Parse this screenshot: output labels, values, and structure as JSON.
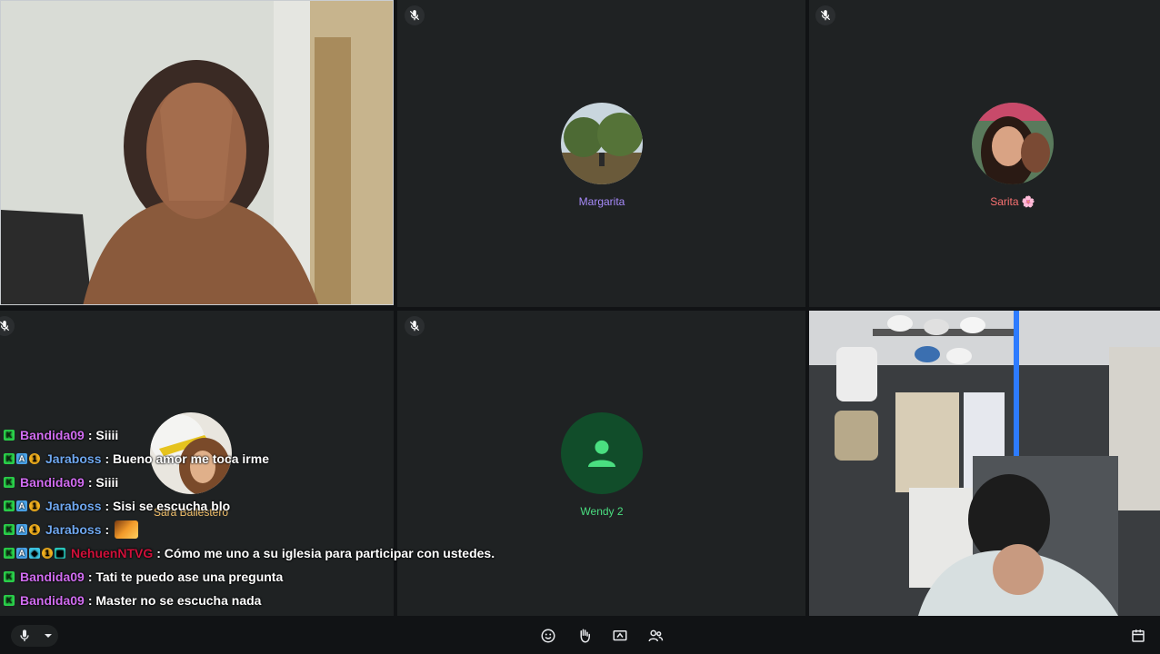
{
  "participants": {
    "margarita": {
      "name": "Margarita",
      "color": "#a78bfa"
    },
    "sarita": {
      "name": "Sarita 🌸",
      "color": "#f87171"
    },
    "sara": {
      "name": "Sara Ballestero",
      "color": "#f5c26b"
    },
    "wendy": {
      "name": "Wendy 2",
      "color": "#4ade80"
    }
  },
  "chat": [
    {
      "user": "Bandida09",
      "user_color": "#d06cf0",
      "badges": [
        "k"
      ],
      "text": ": Siiii"
    },
    {
      "user": "Jaraboss",
      "user_color": "#6fa8f0",
      "badges": [
        "k",
        "a",
        "one"
      ],
      "text": ": Bueno amor me toca irme"
    },
    {
      "user": "Bandida09",
      "user_color": "#d06cf0",
      "badges": [
        "k"
      ],
      "text": ": Siiii"
    },
    {
      "user": "Jaraboss",
      "user_color": "#6fa8f0",
      "badges": [
        "k",
        "a",
        "one"
      ],
      "text": ": Sisi se escucha blo"
    },
    {
      "user": "Jaraboss",
      "user_color": "#6fa8f0",
      "badges": [
        "k",
        "a",
        "one"
      ],
      "text": ":"
    },
    {
      "user": "NehuenNTVG",
      "user_color": "#d0103a",
      "badges": [
        "k",
        "a",
        "cube",
        "one",
        "grid"
      ],
      "text": ": Cómo me uno a su iglesia para participar con ustedes."
    },
    {
      "user": "Bandida09",
      "user_color": "#d06cf0",
      "badges": [
        "k"
      ],
      "text": ": Tati te puedo ase una pregunta"
    },
    {
      "user": "Bandida09",
      "user_color": "#d06cf0",
      "badges": [
        "k"
      ],
      "text": ": Master no se escucha nada"
    }
  ],
  "icons": {
    "mic": "microphone-icon",
    "emoji": "emoji-icon",
    "hand": "raise-hand-icon",
    "present": "present-screen-icon",
    "people": "people-icon",
    "activities": "calendar-icon"
  }
}
